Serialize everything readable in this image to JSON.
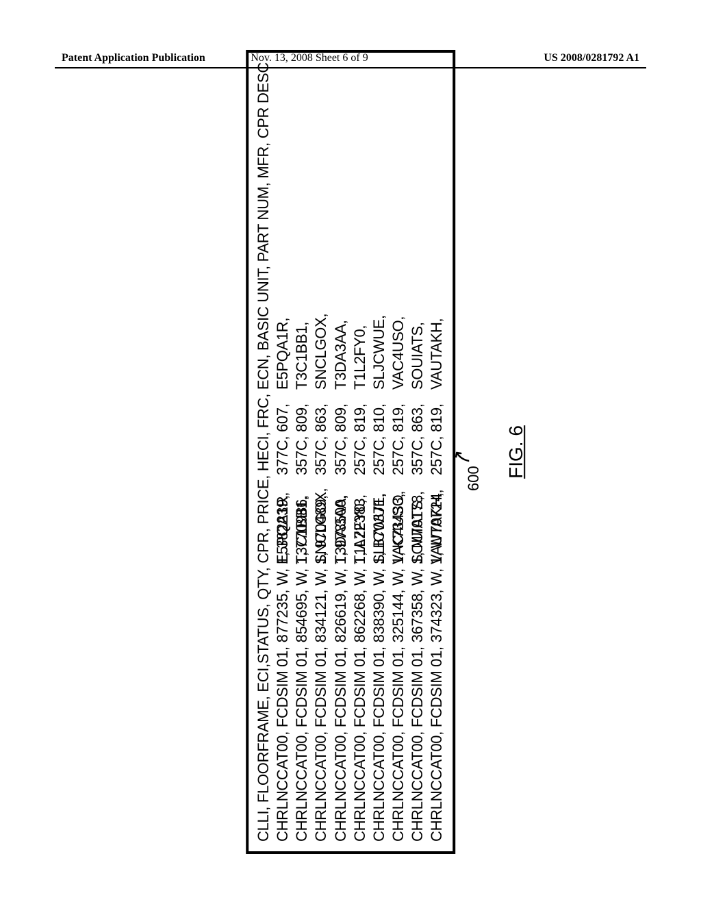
{
  "header": {
    "left": "Patent Application Publication",
    "center": "Nov. 13, 2008  Sheet 6 of 9",
    "right": "US 2008/0281792 A1"
  },
  "figure": {
    "header_row": "CLLI, FLOORFRAME, ECI,STATUS, QTY, CPR, PRICE, HECI, FRC, ECN, BASIC UNIT, PART NUM, MFR, CPR DESC",
    "rows": [
      {
        "c1": "CHRLNCCAT00, FCDSIM  01, 877235, W, 1, 382239,",
        "c2": "E5PQA1R,",
        "c3": "377C,  607,",
        "c4": "E5PQA1R,"
      },
      {
        "c1": "CHRLNCCAT00, FCDSIM  01, 854695, W, 1, 770986,",
        "c2": "T3C1BB1,",
        "c3": "357C,  809,",
        "c4": "T3C1BB1,"
      },
      {
        "c1": "CHRLNCCAT00, FCDSIM  01, 834121, W, 1, 970489,",
        "c2": "SNCLGOX,",
        "c3": "357C,  863,",
        "c4": "SNCLGOX,"
      },
      {
        "c1": "CHRLNCCAT00, FCDSIM  01, 826619, W, 1, 973500,",
        "c2": "T3DA3AA,",
        "c3": "357C,  809,",
        "c4": "T3DA3AA,"
      },
      {
        "c1": "CHRLNCCAT00, FCDSIM  01, 862268, W, 1, A72383,",
        "c2": "T1L2FY0,",
        "c3": "257C,  819,",
        "c4": "T1L2FY0,"
      },
      {
        "c1": "CHRLNCCAT00, FCDSIM  01, 838390, W, 1, B70371,",
        "c2": "SLICWUE,",
        "c3": "257C,  810,",
        "c4": "SLJCWUE,"
      },
      {
        "c1": "CHRLNCCAT00, FCDSIM  01, 325144, W, 1, K73433,",
        "c2": "VAC4USO,",
        "c3": "257C,  819,",
        "c4": "VAC4USO,"
      },
      {
        "c1": "CHRLNCCAT00, FCDSIM  01, 367358, W, 1, M70178,",
        "c2": "SOUIATS,",
        "c3": "357C,  863,",
        "c4": "SOUIATS,"
      },
      {
        "c1": "CHRLNCCAT00, FCDSIM  01, 374323, W, 1, W70724,",
        "c2": "VAUTAKH,",
        "c3": "257C,  819,",
        "c4": "VAUTAKH,"
      }
    ],
    "reference_number": "600",
    "caption": "FIG. 6"
  }
}
